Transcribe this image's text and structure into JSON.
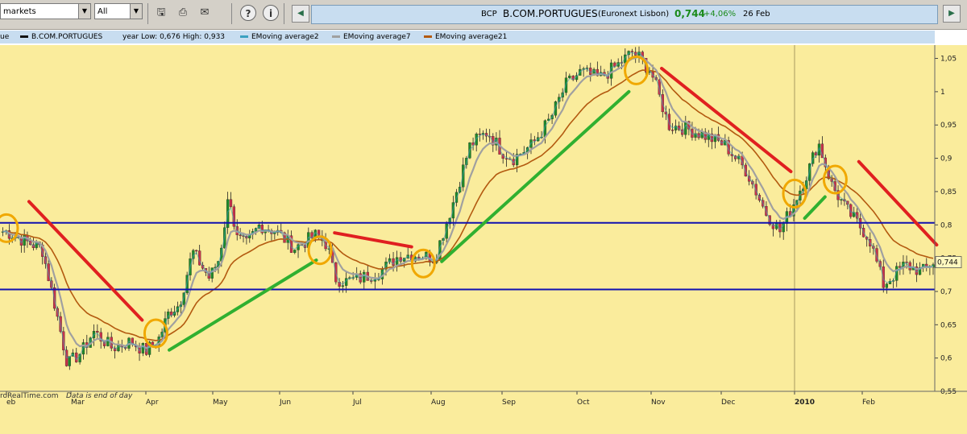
{
  "toolbar": {
    "market_select": "markets",
    "period_select": "All"
  },
  "quote": {
    "ticker": "BCP",
    "name": "B.COM.PORTUGUES",
    "exchange": "(Euronext Lisbon)",
    "price": "0,744",
    "change": "+4,06%",
    "date": "26 Feb"
  },
  "legend": {
    "cut_label": "ue",
    "series_name": "B.COM.PORTUGUES",
    "range_text": "year Low: 0,676 High: 0,933",
    "ema2": "EMoving average2",
    "ema7": "EMoving average7",
    "ema21": "EMoving average21"
  },
  "footer": {
    "source": "roRealTime.com",
    "note": "Data is end of day"
  },
  "colors": {
    "background": "#faec9c",
    "up": "#1f8a2a",
    "down": "#c8324a",
    "ema2": "#3aa0c0",
    "ema7": "#a0a0a0",
    "ema21": "#b35a10",
    "support": "#1010b0",
    "circle": "#f0a800",
    "trend_down": "#e02020",
    "trend_up": "#30b030",
    "header_bg": "#c8ddf0"
  },
  "chart_data": {
    "type": "candlestick",
    "y_axis": {
      "ylim": [
        0.55,
        1.07
      ],
      "ticks": [
        "1,05",
        "1",
        "0,95",
        "0,9",
        "0,85",
        "0,8",
        "0,75",
        "0,7",
        "0,65",
        "0,6",
        "0,55"
      ],
      "tick_values": [
        1.05,
        1.0,
        0.95,
        0.9,
        0.85,
        0.8,
        0.75,
        0.7,
        0.65,
        0.6,
        0.55
      ]
    },
    "x_axis": {
      "months": [
        "eb",
        "Mar",
        "Apr",
        "May",
        "Jun",
        "Jul",
        "Aug",
        "Sep",
        "Oct",
        "Nov",
        "Dec",
        "2010",
        "Feb"
      ],
      "month_index": [
        0,
        1,
        2,
        3,
        4,
        5,
        6,
        7,
        8,
        9,
        10,
        11,
        12
      ]
    },
    "last_price_label": "0,744",
    "price_path_x_months": [
      0,
      0.3,
      0.55,
      0.75,
      0.95,
      1.15,
      1.3,
      1.55,
      1.8,
      2.0,
      2.2,
      2.35,
      2.5,
      2.7,
      2.95,
      3.1,
      3.25,
      3.35,
      3.5,
      3.7,
      3.95,
      4.2,
      4.5,
      4.65,
      4.75,
      4.9,
      5.1,
      5.35,
      5.6,
      5.85,
      6.05,
      6.3,
      6.55,
      6.8,
      7.0,
      7.15,
      7.4,
      7.65,
      7.85,
      8.05,
      8.3,
      8.55,
      8.75,
      8.85,
      9.0,
      9.25,
      9.5,
      9.75,
      10.05,
      10.35,
      10.6,
      10.8,
      11.0,
      11.2,
      11.35,
      11.55,
      11.75,
      11.95,
      12.1,
      12.3,
      12.6,
      12.85,
      13.0
    ],
    "price_path_y": [
      0.79,
      0.775,
      0.765,
      0.68,
      0.59,
      0.61,
      0.64,
      0.615,
      0.625,
      0.61,
      0.63,
      0.67,
      0.68,
      0.76,
      0.72,
      0.75,
      0.85,
      0.78,
      0.77,
      0.8,
      0.79,
      0.765,
      0.785,
      0.77,
      0.72,
      0.715,
      0.72,
      0.73,
      0.755,
      0.755,
      0.75,
      0.83,
      0.92,
      0.94,
      0.91,
      0.9,
      0.92,
      0.96,
      1.01,
      1.03,
      1.02,
      1.04,
      1.06,
      1.05,
      1.03,
      0.95,
      0.945,
      0.935,
      0.92,
      0.88,
      0.82,
      0.79,
      0.835,
      0.88,
      0.925,
      0.86,
      0.825,
      0.8,
      0.78,
      0.71,
      0.74,
      0.73,
      0.744
    ],
    "support_levels": [
      0.803,
      0.703
    ],
    "signal_circles": [
      {
        "x_month": 0.0,
        "y": 0.795
      },
      {
        "x_month": 2.15,
        "y": 0.637
      },
      {
        "x_month": 4.55,
        "y": 0.762
      },
      {
        "x_month": 5.9,
        "y": 0.742
      },
      {
        "x_month": 8.8,
        "y": 1.032
      },
      {
        "x_month": 11.0,
        "y": 0.847
      },
      {
        "x_month": 11.6,
        "y": 0.868
      }
    ],
    "trend_lines_down": [
      {
        "x1": 0.35,
        "y1": 0.835,
        "x2": 1.95,
        "y2": 0.657
      },
      {
        "x1": 4.75,
        "y1": 0.788,
        "x2": 5.75,
        "y2": 0.767
      },
      {
        "x1": 9.15,
        "y1": 1.035,
        "x2": 10.95,
        "y2": 0.88
      },
      {
        "x1": 11.95,
        "y1": 0.895,
        "x2": 13.05,
        "y2": 0.77
      }
    ],
    "trend_lines_up": [
      {
        "x1": 2.35,
        "y1": 0.612,
        "x2": 4.5,
        "y2": 0.747
      },
      {
        "x1": 6.15,
        "y1": 0.745,
        "x2": 8.7,
        "y2": 1.0
      },
      {
        "x1": 11.15,
        "y1": 0.81,
        "x2": 11.45,
        "y2": 0.842
      }
    ]
  }
}
